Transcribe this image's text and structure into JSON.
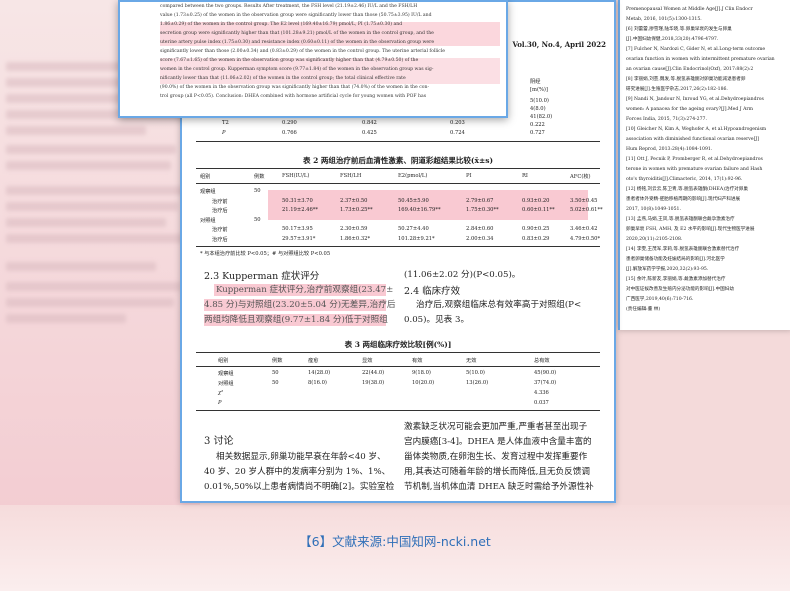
{
  "journal_header": "Vol.30, No.4, April 2022",
  "top_page": {
    "lines": [
      "compared between the two groups. Results After treatment, the FSH level (21.19±2.46) IU/L and the FSH/LH",
      "value (1.73±0.25) of the women in the observation group were significantly lower than those (50.75±3.95) IU/L and",
      "1.86±0.29) of the women in the control group. The E2 level (169.40±16.79) pmol/L, PI (1.75±0.30) and",
      "secretion group were significantly higher than that (101.28±9.21) pmol/L of the women in the control group, and the",
      "uterine artery pulse index (1.75±0.30) and resistance index (0.60±0.11) of the women in the observation group were",
      "significantly lower than those (2.00±0.34) and (0.83±0.29) of the women in the control group. The uterine arterial follicle",
      "score (7.67±1.65) of the women in the observation group was significantly higher than that (4.79±0.50) of the",
      "women in the control group. Kupperman symptom score (9.77±1.84) of the women in the observation group was sig-",
      "nificantly lower than that (11.06±2.02) of the women in the control group; the total clinical effective rate",
      "(90.0%) of the women in the observation group was significantly higher than that (74.0%) of the women in the con-",
      "trol group (all P<0.05). Conclusion: DHEA combined with hormone artificial cycle for young women with POF has"
    ],
    "table_rows": [
      [
        "T2",
        "0.290",
        "0.842",
        "0.203"
      ],
      [
        "P",
        "0.766",
        "0.425",
        "0.724",
        "0.727"
      ]
    ],
    "right_header": [
      "阴经",
      "[m(%)]"
    ],
    "right_vals": [
      "5(10.0)",
      "4(8.0)",
      "41(82.0)",
      "0.222"
    ]
  },
  "table2": {
    "caption": "表 2  两组治疗前后血清性激素、阴道彩超结果比较(x̄±s)",
    "headers": [
      "组别",
      "例数",
      "FSH(IU/L)",
      "FSH/LH",
      "E2(pmol/L)",
      "PI",
      "RI",
      "AFC(枚)"
    ],
    "rows": [
      [
        "观察组",
        "50",
        "",
        "",
        "",
        "",
        "",
        ""
      ],
      [
        "治疗前",
        "",
        "50.31±3.70",
        "2.37±0.50",
        "50.45±5.90",
        "2.79±0.67",
        "0.93±0.20",
        "3.50±0.45"
      ],
      [
        "治疗后",
        "",
        "21.19±2.46**",
        "1.73±0.25**",
        "169.40±16.79**",
        "1.75±0.30**",
        "0.60±0.11**",
        "5.02±0.61**"
      ],
      [
        "对照组",
        "50",
        "",
        "",
        "",
        "",
        "",
        ""
      ],
      [
        "治疗前",
        "",
        "50.17±3.95",
        "2.30±0.59",
        "50.27±4.40",
        "2.84±0.60",
        "0.90±0.25",
        "3.46±0.42"
      ],
      [
        "治疗后",
        "",
        "29.57±3.91*",
        "1.86±0.32*",
        "101.28±9.21*",
        "2.00±0.34",
        "0.83±0.29",
        "4.79±0.50*"
      ]
    ],
    "note": "* 与本组治疗前比较  P<0.05；# 与对照组比较  P<0.05"
  },
  "section_2_3": {
    "heading": "2.3 Kupperman 症状评分",
    "lines": [
      "Kupperman 症状评分,治疗前观察组(23.47±",
      "4.85 分)与对照组(23.20±5.04 分)无差异,治疗后",
      "两组均降低且观察组(9.77±1.84 分)低于对照组"
    ]
  },
  "section_2_4": {
    "pre": "(11.06±2.02 分)(P<0.05)。",
    "heading": "2.4 临床疗效",
    "lines": [
      "治疗后,观察组临床总有效率高于对照组(P<",
      "0.05)。见表 3。"
    ]
  },
  "table3": {
    "caption": "表 3  两组临床疗效比较[例(%)]",
    "headers": [
      "组别",
      "例数",
      "痊愈",
      "显效",
      "有效",
      "无效",
      "总有效"
    ],
    "rows": [
      [
        "观察组",
        "50",
        "14(28.0)",
        "22(44.0)",
        "9(18.0)",
        "5(10.0)",
        "45(90.0)"
      ],
      [
        "对照组",
        "50",
        "8(16.0)",
        "19(38.0)",
        "10(20.0)",
        "13(26.0)",
        "37(74.0)"
      ],
      [
        "χ²",
        "",
        "",
        "",
        "",
        "",
        "4.336"
      ],
      [
        "P",
        "",
        "",
        "",
        "",
        "",
        "0.037"
      ]
    ]
  },
  "discussion": {
    "heading": "3 讨论",
    "left_lines": [
      "相关数据显示,卵巢功能早衰在年龄<40 岁、",
      "40 岁、20 岁人群中的发病率分别为 1%、1%、",
      "0.01%,50%以上患者病情尚不明确[2]。实验室检"
    ],
    "right_lines": [
      "激素缺乏状况可能会更加严重,严重者甚至出现子",
      "宫内膜癌[3-4]。DHEA 是人体血液中含量丰富的",
      "甾体类物质,在卵泡生长、发育过程中发挥重要作",
      "用,其表达可随着年龄的增长而降低,且无负反馈调",
      "节机制,当机体血清 DHEA 缺乏时需给予外源性补"
    ]
  },
  "right_page_refs": [
    "Premenopausal Women at Middle Age[J].J Clin Endocr",
    "Metab, 2016, 101(5):1300-1315.",
    "[6] 刘蕾蕾,廖雪瑾,陆华晓,等.卵巢早衰的发生与卵巢",
    "[J].中国妇幼保健,2018,33(20):4796-4797.",
    "[7] Fulcher N, Nardozi C, Gider N, et al.Long-term outcome",
    "ovarian function in women with intermittent premature ovarian",
    "an ovarian cause[J].Clin Endocrinol(Oxf), 2017:88(2):2",
    "[8] 李丽娟,刘芸,魏发,等.脱氢表雄酮对卵巢功能减退患者卵",
    "研究进展[J].生殖医学杂志,2017,26(2):182-186.",
    "[9] Nandi N, Jandour N, Inroud YG, et al.Dehydroepiandros",
    "women: A panacea for the ageing ovary?[J].Med J Arm",
    "Forces India, 2015, 71(3):274-277.",
    "[10] Gleicher N, Kim A, Weghofer A, et al.Hypoandrogenism",
    "association with diminished functional ovarian reserve[J]",
    "Hum Reprod, 2013:28(4):1084-1091.",
    "[11] Ott J, Pecnik P, Promberger R, et al.Dehydroepiandros",
    "terone in women with premature ovarian failure and Hash",
    "oto's thyroiditis[J].Climacteric, 2014, 17(1):92-96.",
    "[12] 杨铭,刘云云,陈卫青,等.脱氢表雄酮(DHEA)治疗对卵巢",
    "患者者体外受精-胚胎移植周期的影响[J].现代妇产科进展",
    "2017, 10(8):1049-1051.",
    "[13] 孟燕,马娟,王凤,等.脱氢表雄酮联合雌孕激素治疗",
    "卵巢早衰 FSH, AMH, 及 E2 水平的影响[J].现代生物医学进展",
    "2020,20(11):2105-2108.",
    "[14] 李雯,王茂军,李莉,等.脱氢表雄酮联合激素替代治疗",
    "患者卵巢储备功能及妊娠结局的影响[J].河北医学",
    "[J].解放军药学学报,2020,32(2):93-95.",
    "[15] 余叶,陈新友,李丽娟,等.雌激素添加替代治疗",
    "对中医证候改善及生殖内分泌功能的影响[J].中国妇幼",
    "广西医学,2019,40(6):710-716.",
    "(责任编辑:董  林)"
  ],
  "footer_credit": "【6】文献来源:中国知网-ncki.net"
}
